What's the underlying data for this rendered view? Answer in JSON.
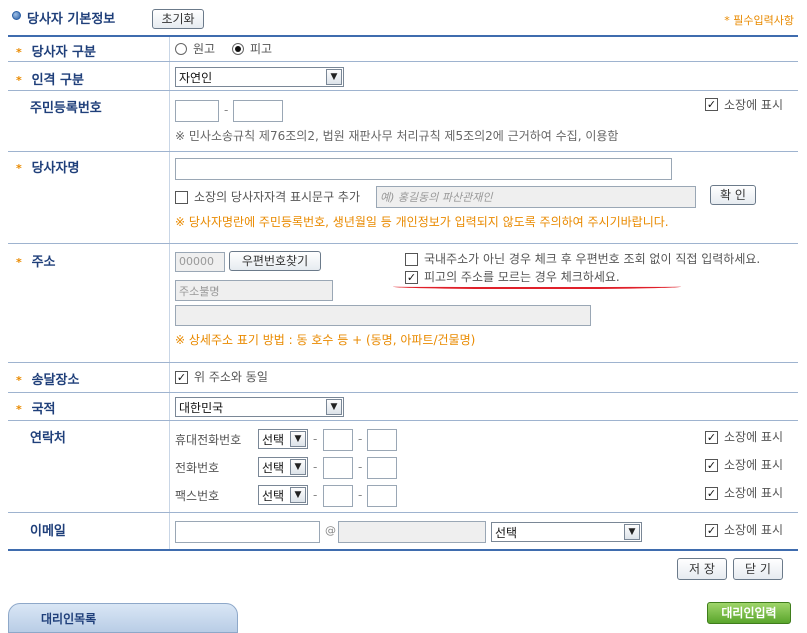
{
  "header": {
    "title": "당사자 기본정보",
    "reset_button": "초기화",
    "required_note": "* 필수입력사항"
  },
  "party_type": {
    "label": "당사자 구분",
    "options": [
      "원고",
      "피고"
    ],
    "selected": "피고"
  },
  "personality": {
    "label": "인격 구분",
    "value": "자연인"
  },
  "resident_number": {
    "label": "주민등록번호",
    "separator": "-",
    "show_label": "소장에 표시",
    "note": "※ 민사소송규칙 제76조의2, 법원 재판사무 처리규칙 제5조의2에 근거하여 수집, 이용함"
  },
  "party_name": {
    "label": "당사자명",
    "qualifier_label": "소장의 당사자자격 표시문구 추가",
    "qualifier_placeholder": "예) 홍길동의 파산관재인",
    "confirm_button": "확 인",
    "warning": "※ 당사자명란에 주민등록번호, 생년월일 등 개인정보가 입력되지 않도록 주의하여 주시기바랍니다."
  },
  "address": {
    "label": "주소",
    "zip_placeholder": "00000",
    "zip_button": "우편번호찾기",
    "addr_placeholder": "주소불명",
    "foreign_check_label": "국내주소가 아닌 경우 체크 후 우편번호 조회 없이 직접 입력하세요.",
    "unknown_check_label": "피고의 주소를 모르는 경우 체크하세요.",
    "detail_note": "※ 상세주소 표기 방법 : 동 호수 등 + (동명, 아파트/건물명)"
  },
  "delivery": {
    "label": "송달장소",
    "same_label": "위 주소와 동일"
  },
  "nationality": {
    "label": "국적",
    "value": "대한민국"
  },
  "contact": {
    "label": "연락처",
    "rows": [
      {
        "label": "휴대전화번호",
        "select": "선택"
      },
      {
        "label": "전화번호",
        "select": "선택"
      },
      {
        "label": "팩스번호",
        "select": "선택"
      }
    ],
    "separator": "-",
    "show_label": "소장에 표시"
  },
  "email": {
    "label": "이메일",
    "at": "@",
    "domain_select": "선택",
    "show_label": "소장에 표시"
  },
  "footer": {
    "save_button": "저 장",
    "close_button": "닫 기",
    "agent_tab": "대리인목록",
    "agent_input_button": "대리인입력"
  },
  "colors": {
    "accent": "#1f3f7a",
    "required": "#e98a00",
    "underline": "#e0202a",
    "green": "#5aa52c"
  }
}
